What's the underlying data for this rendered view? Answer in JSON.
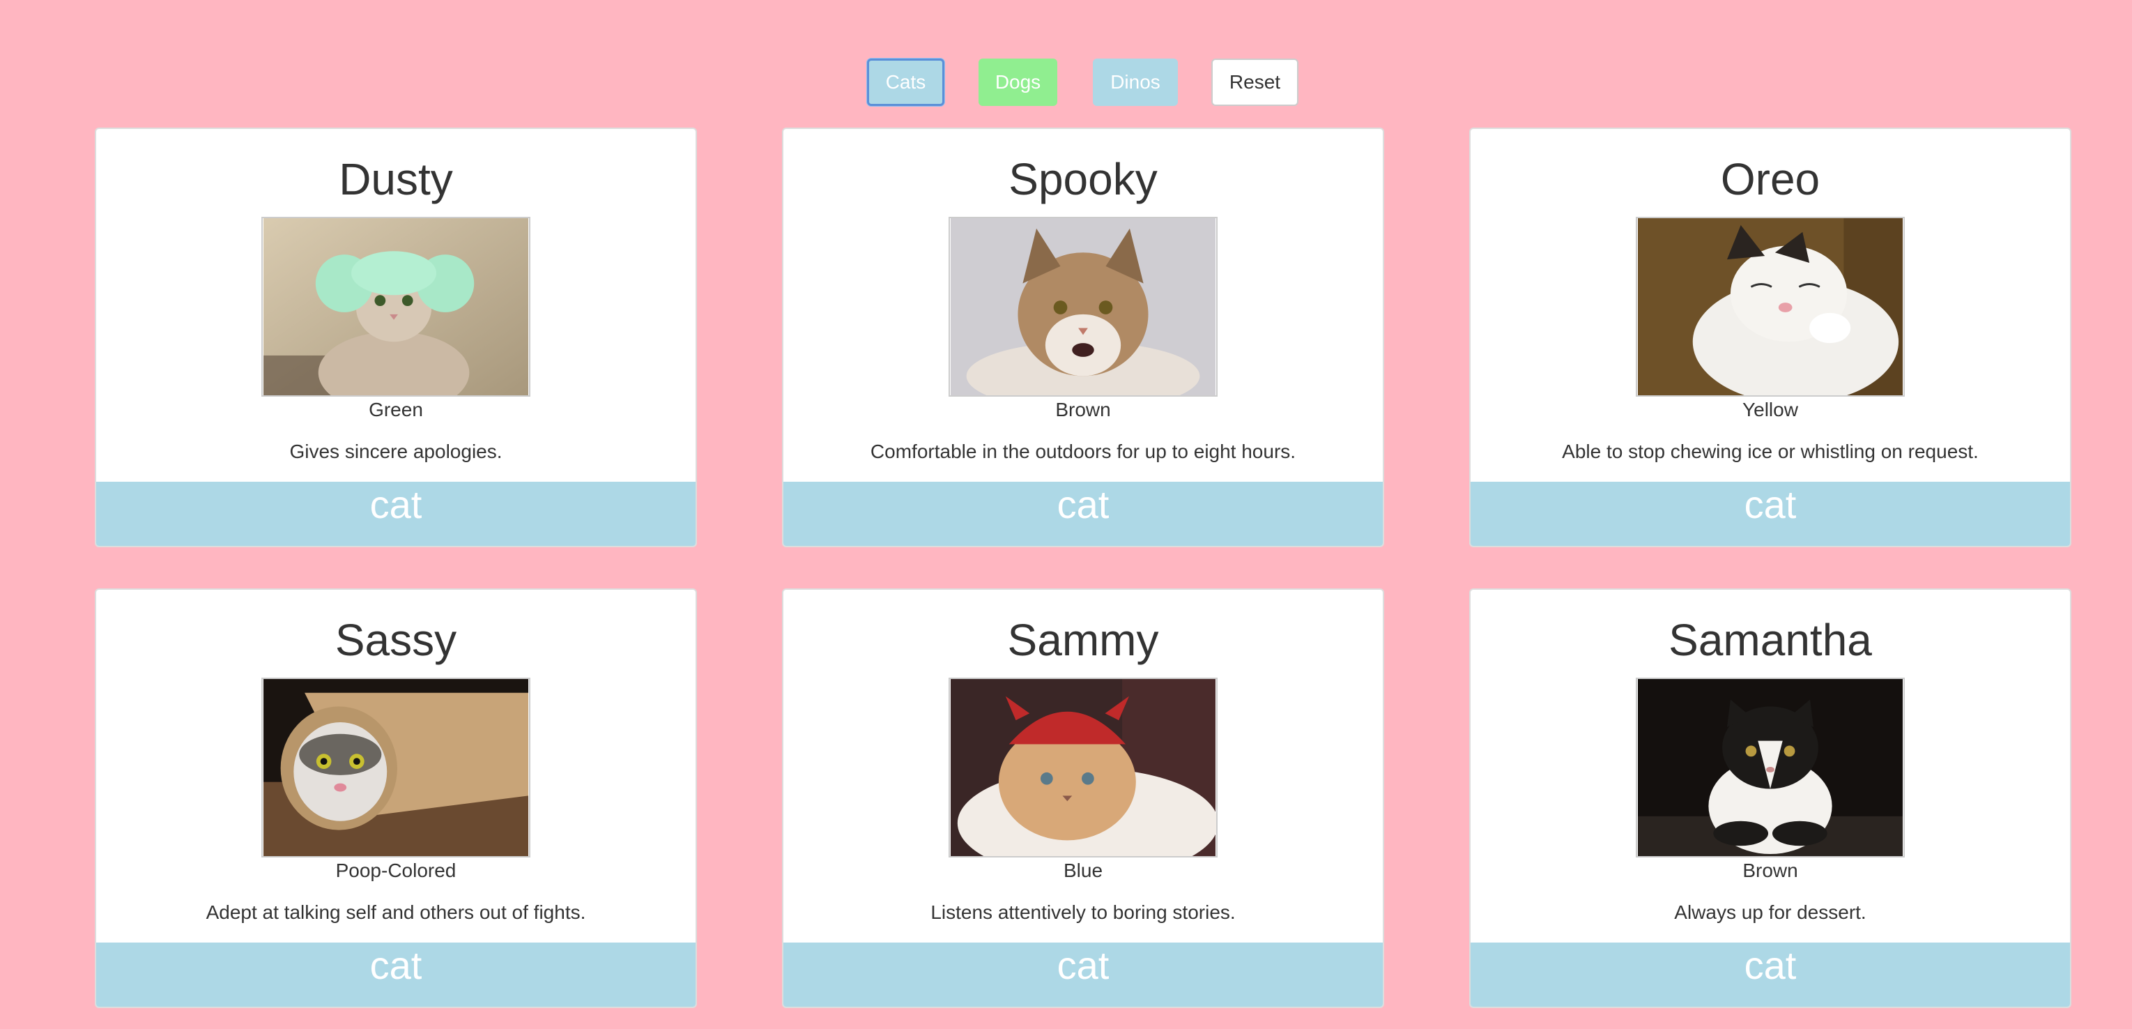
{
  "filters": {
    "cats_label": "Cats",
    "dogs_label": "Dogs",
    "dinos_label": "Dinos",
    "reset_label": "Reset"
  },
  "colors": {
    "page_background": "#ffb6c1",
    "cats_button": "#add8e6",
    "dogs_button": "#90ee90",
    "dinos_button": "#add8e6",
    "cat_footer": "#add8e6"
  },
  "pets": [
    {
      "name": "Dusty",
      "color": "Green",
      "description": "Gives sincere apologies.",
      "type": "cat",
      "photo_icon": "cat-in-green-knit-hat-photo"
    },
    {
      "name": "Spooky",
      "color": "Brown",
      "description": "Comfortable in the outdoors for up to eight hours.",
      "type": "cat",
      "photo_icon": "maine-coon-cat-photo"
    },
    {
      "name": "Oreo",
      "color": "Yellow",
      "description": "Able to stop chewing ice or whistling on request.",
      "type": "cat",
      "photo_icon": "sleepy-white-cat-photo"
    },
    {
      "name": "Sassy",
      "color": "Poop-Colored",
      "description": "Adept at talking self and others out of fights.",
      "type": "cat",
      "photo_icon": "cat-in-paper-tube-photo"
    },
    {
      "name": "Sammy",
      "color": "Blue",
      "description": "Listens attentively to boring stories.",
      "type": "cat",
      "photo_icon": "cat-in-red-devil-hat-photo"
    },
    {
      "name": "Samantha",
      "color": "Brown",
      "description": "Always up for dessert.",
      "type": "cat",
      "photo_icon": "black-and-white-cat-photo"
    }
  ]
}
